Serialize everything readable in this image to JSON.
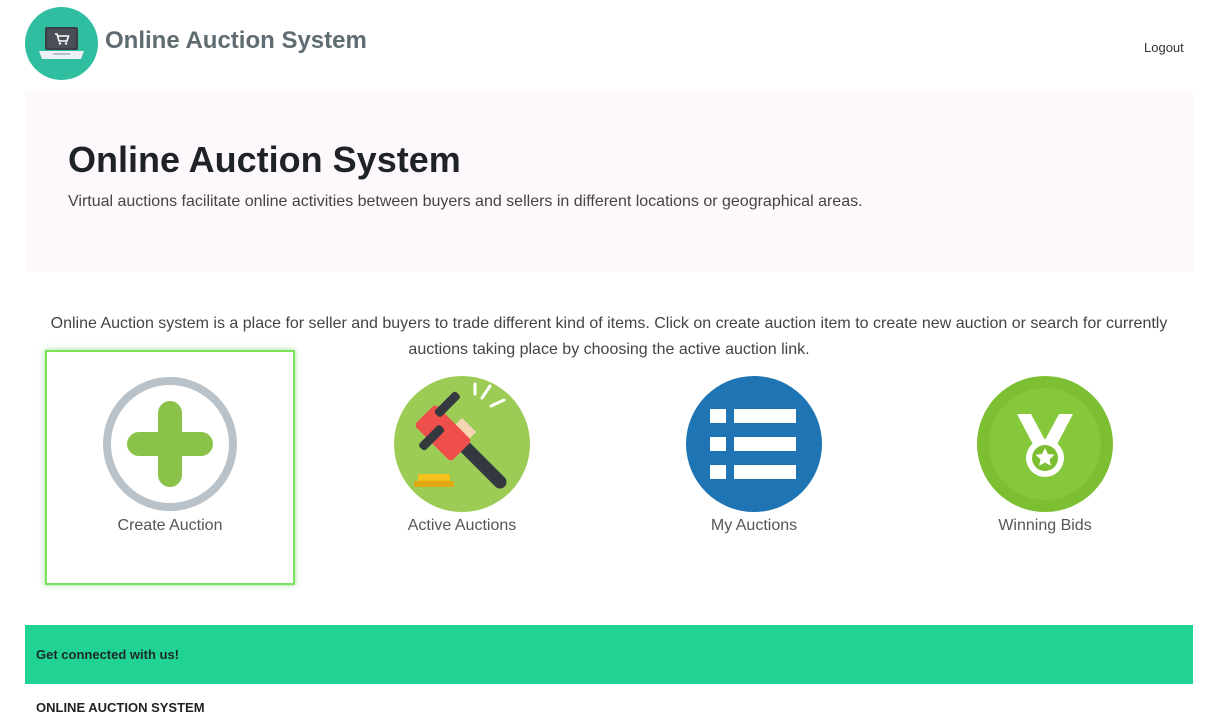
{
  "header": {
    "brand": "Online Auction System",
    "logout": "Logout"
  },
  "jumbotron": {
    "title": "Online Auction System",
    "subtitle": "Virtual auctions facilitate online activities between buyers and sellers in different locations or geographical areas."
  },
  "intro": "Online Auction system is a place for seller and buyers to trade different kind of items. Click on create auction item to create new auction or search for currently auctions taking place by choosing the active auction link.",
  "tiles": [
    {
      "label": "Create Auction",
      "icon": "plus-circle-icon",
      "selected": true
    },
    {
      "label": "Active Auctions",
      "icon": "gavel-icon",
      "selected": false
    },
    {
      "label": "My Auctions",
      "icon": "list-icon",
      "selected": false
    },
    {
      "label": "Winning Bids",
      "icon": "medal-icon",
      "selected": false
    }
  ],
  "footer": {
    "banner": "Get connected with us!",
    "brand": "ONLINE AUCTION SYSTEM"
  },
  "colors": {
    "logo_bg": "#2fbfa0",
    "footer_band": "#21d393",
    "jumbotron_bg": "#fdf8fc",
    "selected_border": "#7be05a",
    "plus_green": "#8bc34a",
    "gavel_bg": "#9ccc55",
    "list_bg": "#1f75b4",
    "medal_bg": "#7cbf32"
  }
}
